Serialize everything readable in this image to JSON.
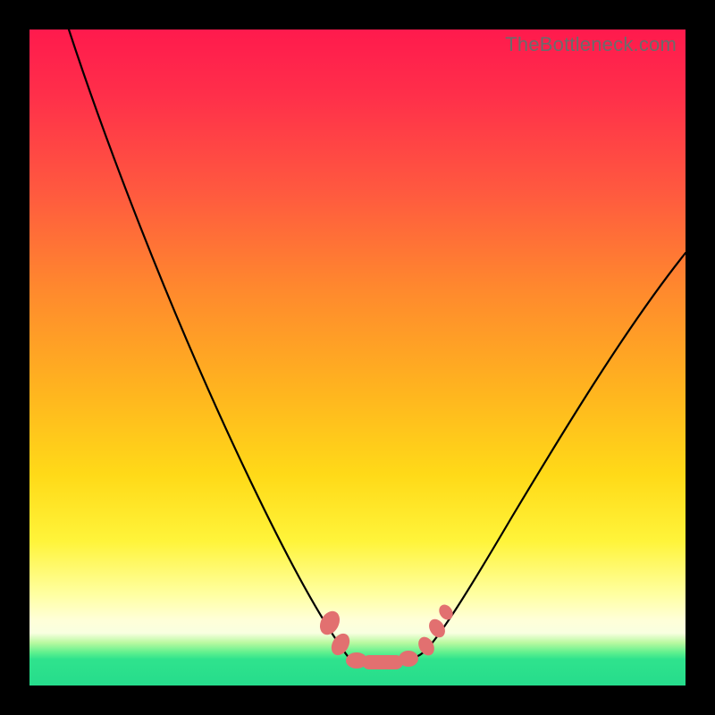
{
  "watermark": "TheBottleneck.com",
  "colors": {
    "frame": "#000000",
    "gradient_top": "#ff1a4d",
    "gradient_mid": "#ffda18",
    "gradient_pale": "#ffffd8",
    "gradient_green": "#26dc8c",
    "curve": "#000000",
    "marker": "#e27070"
  },
  "chart_data": {
    "type": "line",
    "title": "",
    "xlabel": "",
    "ylabel": "",
    "xlim": [
      0,
      100
    ],
    "ylim": [
      0,
      100
    ],
    "grid": false,
    "legend": false,
    "series": [
      {
        "name": "left-branch",
        "x": [
          6,
          10,
          15,
          20,
          25,
          30,
          35,
          40,
          43,
          45,
          47
        ],
        "y": [
          100,
          86,
          71,
          58,
          46,
          35,
          25,
          14,
          8,
          5,
          4
        ]
      },
      {
        "name": "valley",
        "x": [
          47,
          50,
          53,
          56,
          59
        ],
        "y": [
          4,
          3.5,
          3.5,
          3.8,
          5
        ]
      },
      {
        "name": "right-branch",
        "x": [
          59,
          62,
          66,
          72,
          80,
          90,
          100
        ],
        "y": [
          5,
          8,
          13,
          22,
          35,
          50,
          66
        ]
      }
    ],
    "markers": {
      "name": "highlighted-points",
      "shape": "rounded-blob",
      "color": "#e27070",
      "points": [
        {
          "x": 45,
          "y": 9
        },
        {
          "x": 46,
          "y": 6
        },
        {
          "x": 49,
          "y": 3.5
        },
        {
          "x": 53,
          "y": 3.5
        },
        {
          "x": 57,
          "y": 4.2
        },
        {
          "x": 60,
          "y": 6.5
        },
        {
          "x": 62,
          "y": 9
        }
      ]
    },
    "annotations": []
  }
}
